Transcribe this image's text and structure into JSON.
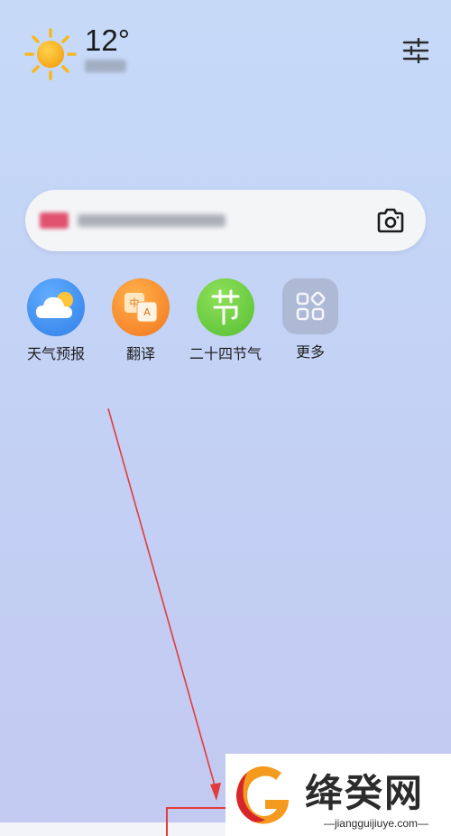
{
  "weather": {
    "temperature": "12°",
    "icon": "sun-icon"
  },
  "header": {
    "settings_icon": "sliders-icon"
  },
  "search": {
    "camera_icon": "camera-icon"
  },
  "apps": [
    {
      "label": "天气预报",
      "icon": "weather-cloud-icon",
      "color": "#3d8ef0"
    },
    {
      "label": "翻译",
      "icon": "translate-icon",
      "color": "#f5862a"
    },
    {
      "label": "二十四节气",
      "icon": "solar-terms-icon",
      "color": "#6fcf45"
    },
    {
      "label": "更多",
      "icon": "more-apps-icon",
      "color": "#aab7d4"
    }
  ],
  "watermark": {
    "title": "绛癸网",
    "url": "jiangguijiuye.com",
    "colors": {
      "orange": "#f39a1f",
      "red": "#d6262a"
    }
  },
  "annotation_color": "#e33b3b"
}
